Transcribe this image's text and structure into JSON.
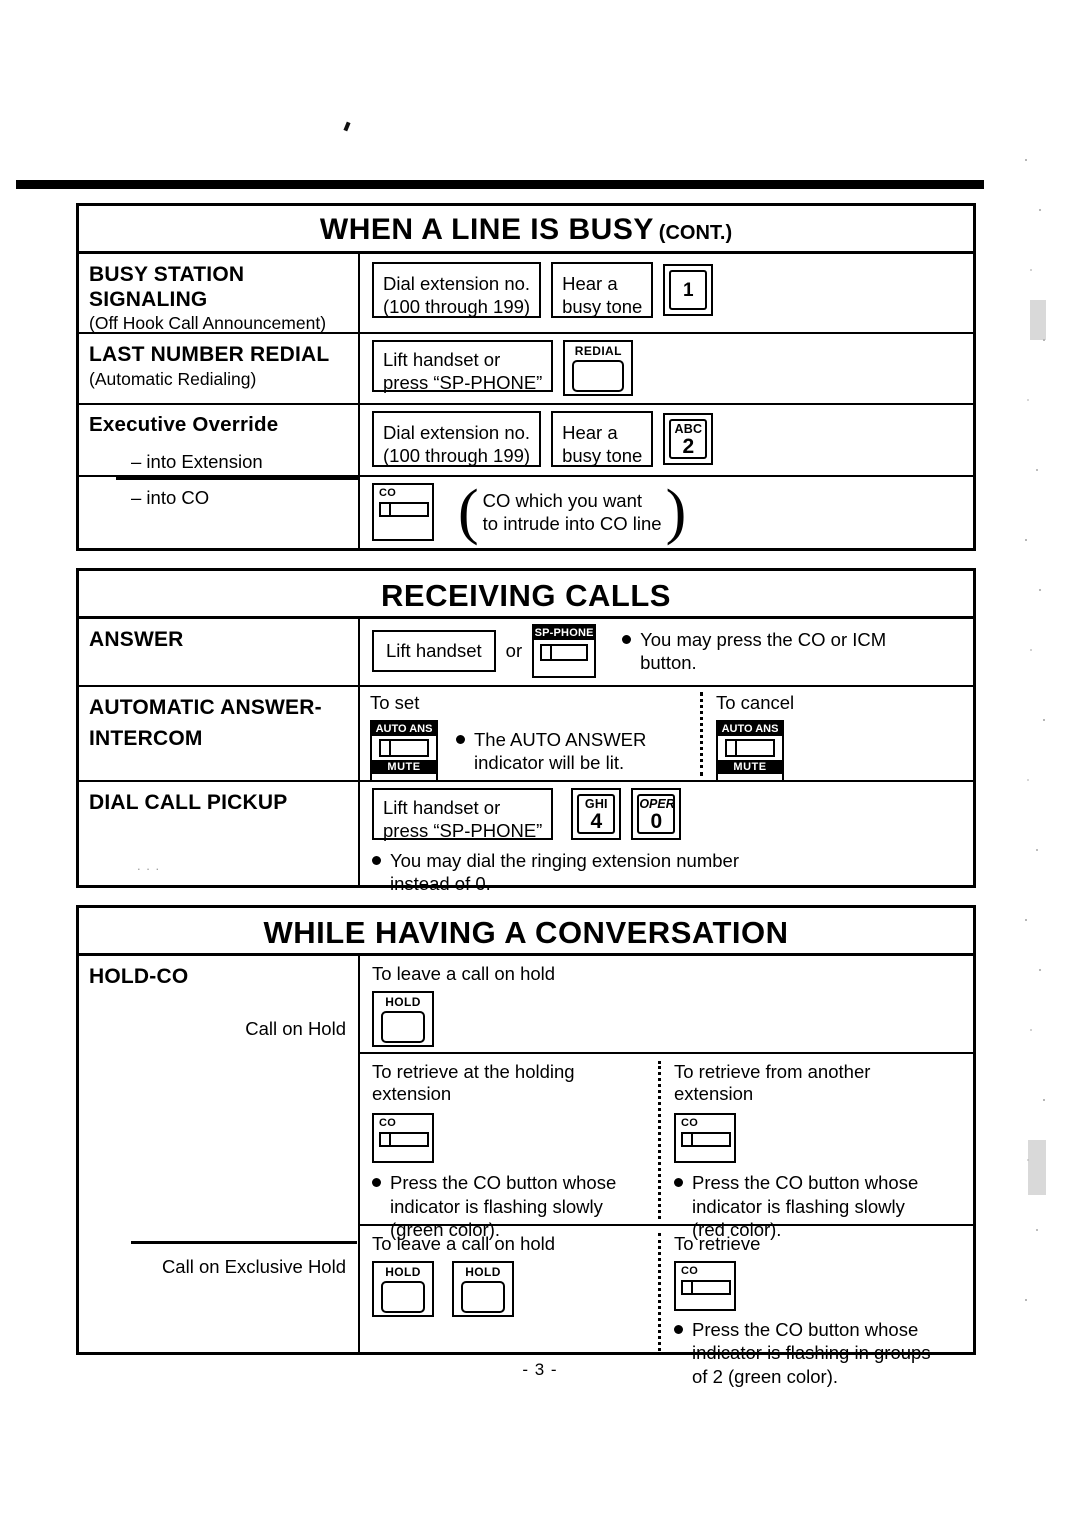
{
  "page": {
    "number_label": "- 3 -"
  },
  "sections": [
    {
      "id": "when-a-line-is-busy",
      "title": "WHEN A LINE IS BUSY",
      "title_suffix": "(CONT.)",
      "rows": [
        {
          "id": "busy-station-signaling",
          "heading": "BUSY STATION",
          "heading2": "SIGNALING",
          "subheading": "(Off Hook Call Announcement)",
          "steps": [
            {
              "type": "box",
              "line1": "Dial extension no.",
              "line2": "(100 through 199)"
            },
            {
              "type": "box",
              "line1": "Hear a",
              "line2": "busy tone"
            },
            {
              "type": "key",
              "alpha": "",
              "digit": "1"
            }
          ]
        },
        {
          "id": "last-number-redial",
          "heading": "LAST NUMBER REDIAL",
          "subheading": "(Automatic Redialing)",
          "steps": [
            {
              "type": "box",
              "line1": "Lift handset or",
              "line2": "press “SP-PHONE”"
            },
            {
              "type": "button-label",
              "label": "REDIAL"
            }
          ]
        },
        {
          "id": "executive-override-into-extension",
          "heading": "Executive Override",
          "item": "– into Extension",
          "steps": [
            {
              "type": "box",
              "line1": "Dial extension no.",
              "line2": "(100 through 199)"
            },
            {
              "type": "box",
              "line1": "Hear a",
              "line2": "busy tone"
            },
            {
              "type": "key",
              "alpha": "ABC",
              "digit": "2"
            }
          ]
        },
        {
          "id": "executive-override-into-co",
          "item": "– into CO",
          "steps": [
            {
              "type": "button-co",
              "label": "CO"
            }
          ],
          "note_line1": "CO which you want",
          "note_line2": "to intrude into CO line"
        }
      ]
    },
    {
      "id": "receiving-calls",
      "title": "RECEIVING CALLS",
      "rows": [
        {
          "id": "answer",
          "heading": "ANSWER",
          "step_box": "Lift handset",
          "connector": "or",
          "button_label": "SP-PHONE",
          "bullet1": "You may press the CO or ICM",
          "bullet2": "button."
        },
        {
          "id": "automatic-answer-intercom",
          "heading": "AUTOMATIC ANSWER-",
          "heading2": "INTERCOM",
          "set_label": "To set",
          "cancel_label": "To cancel",
          "button_top": "AUTO ANS",
          "button_bottom": "MUTE",
          "bullet1": "The AUTO ANSWER",
          "bullet2": "indicator will be lit."
        },
        {
          "id": "dial-call-pickup",
          "heading": "DIAL CALL PICKUP",
          "step_line1": "Lift handset or",
          "step_line2": "press “SP-PHONE”",
          "key1": {
            "alpha": "GHI",
            "digit": "4"
          },
          "key2": {
            "alpha": "OPER",
            "digit": "0"
          },
          "bullet1": "You may dial the ringing extension number",
          "bullet2": "instead of 0."
        }
      ]
    },
    {
      "id": "while-having-a-conversation",
      "title": "WHILE HAVING A CONVERSATION",
      "rows": [
        {
          "id": "hold-co",
          "heading": "HOLD-CO",
          "sub_label_1": "Call on Hold",
          "sub_label_2": "Call on Exclusive Hold",
          "hold_block": {
            "title": "To leave a call on hold",
            "button_label": "HOLD"
          },
          "retrieve_blocks": [
            {
              "id": "retrieve-holding-extension",
              "title_line1": "To retrieve at the holding",
              "title_line2": "extension",
              "button_label": "CO",
              "bullet1": "Press the CO button whose",
              "bullet2": "indicator is flashing slowly",
              "bullet3": "(green color)."
            },
            {
              "id": "retrieve-another-extension",
              "title_line1": "To retrieve from another",
              "title_line2": "extension",
              "button_label": "CO",
              "bullet1": "Press the CO button whose",
              "bullet2": "indicator is flashing slowly",
              "bullet3": "(red color)."
            }
          ],
          "exclusive_hold": {
            "leave_title": "To leave a call on hold",
            "button_label_1": "HOLD",
            "button_label_2": "HOLD",
            "retrieve_title": "To retrieve",
            "co_label": "CO",
            "bullet1": "Press the CO button whose",
            "bullet2": "indicator is flashing in groups",
            "bullet3": "of 2 (green color)."
          }
        }
      ]
    }
  ],
  "colors": {
    "ink": "#000000",
    "paper": "#ffffff"
  }
}
